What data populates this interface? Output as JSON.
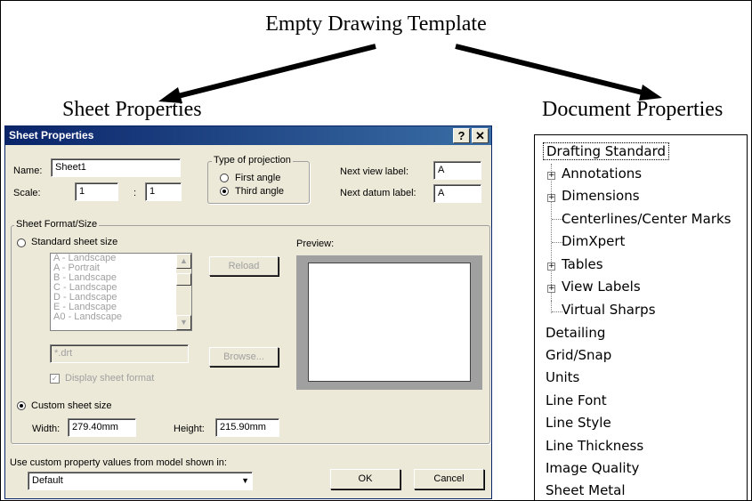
{
  "headings": {
    "main": "Empty Drawing Template",
    "left": "Sheet Properties",
    "right": "Document Properties"
  },
  "dialog": {
    "title": "Sheet Properties",
    "help_glyph": "?",
    "close_glyph": "✕",
    "name_label": "Name:",
    "name_value": "Sheet1",
    "scale_label": "Scale:",
    "scale_num": "1",
    "scale_sep": ":",
    "scale_den": "1",
    "projection_group": "Type of projection",
    "first_angle": "First angle",
    "third_angle": "Third angle",
    "projection_selected": "Third angle",
    "next_view_label": "Next view label:",
    "next_view_value": "A",
    "next_datum_label": "Next datum label:",
    "next_datum_value": "A",
    "format_group": "Sheet Format/Size",
    "standard_size": "Standard sheet size",
    "sheet_sizes": [
      "A - Landscape",
      "A - Portrait",
      "B - Landscape",
      "C - Landscape",
      "D - Landscape",
      "E - Landscape",
      "A0 - Landscape"
    ],
    "reload": "Reload",
    "preview": "Preview:",
    "format_file": "*.drt",
    "browse": "Browse...",
    "display_format": "Display sheet format",
    "custom_size": "Custom sheet size",
    "width_label": "Width:",
    "width_value": "279.40mm",
    "height_label": "Height:",
    "height_value": "215.90mm",
    "custom_prop_label": "Use custom property values from model shown in:",
    "custom_prop_value": "Default",
    "ok": "OK",
    "cancel": "Cancel"
  },
  "tree": {
    "root": "Drafting Standard",
    "children": [
      "Annotations",
      "Dimensions",
      "Centerlines/Center Marks",
      "DimXpert",
      "Tables",
      "View Labels",
      "Virtual Sharps"
    ],
    "top_items": [
      "Detailing",
      "Grid/Snap",
      "Units",
      "Line Font",
      "Line Style",
      "Line Thickness",
      "Image Quality",
      "Sheet Metal"
    ]
  },
  "colors": {
    "titlebar": "#0a246a",
    "dialog_bg": "#ece9d8",
    "disabled_text": "#a0a0a0"
  }
}
